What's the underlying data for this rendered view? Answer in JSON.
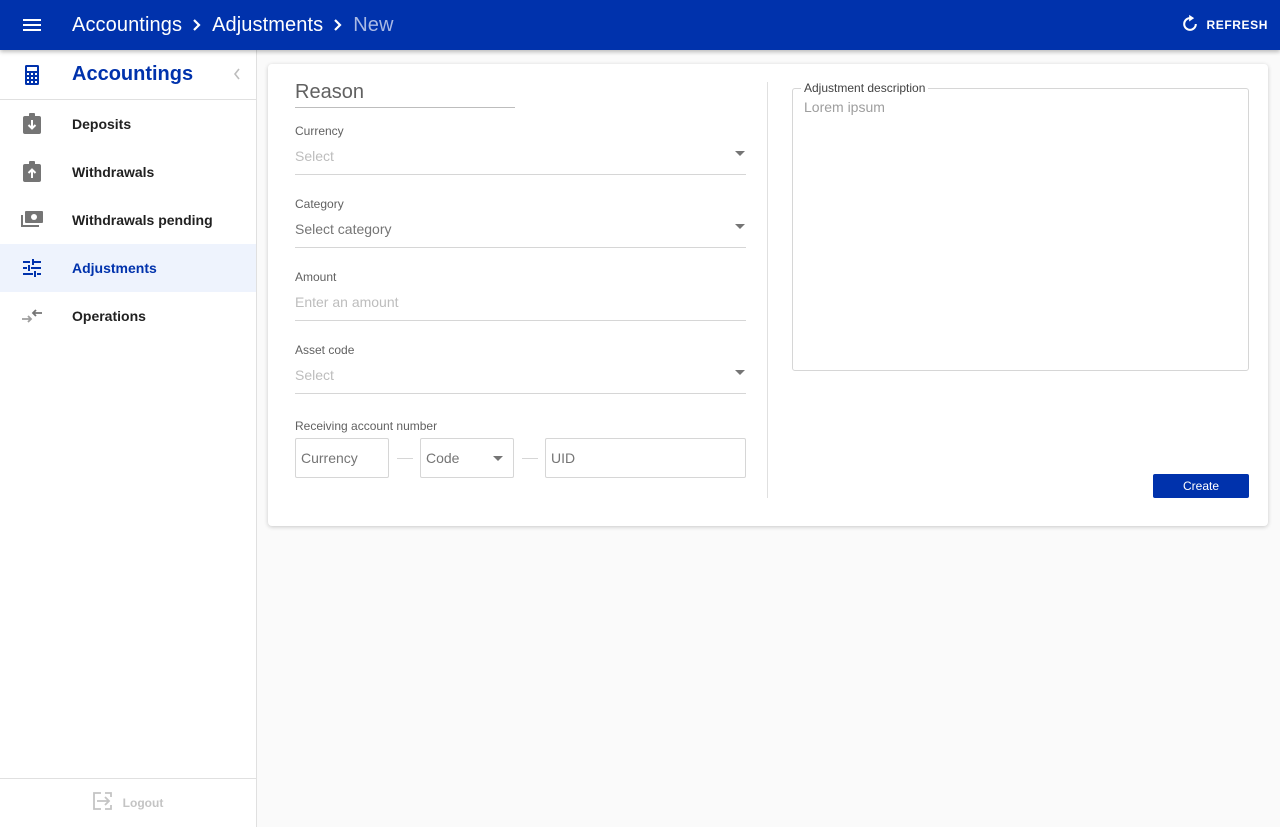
{
  "appbar": {
    "breadcrumbs": [
      "Accountings",
      "Adjustments",
      "New"
    ],
    "refresh_label": "REFRESH",
    "background": "#0032ac"
  },
  "sidebar": {
    "title": "Accountings",
    "title_icon": "calculator-icon",
    "items": [
      {
        "label": "Deposits",
        "icon": "deposit-icon",
        "active": false
      },
      {
        "label": "Withdrawals",
        "icon": "withdrawal-icon",
        "active": false
      },
      {
        "label": "Withdrawals pending",
        "icon": "money-icon",
        "active": false
      },
      {
        "label": "Adjustments",
        "icon": "tune-icon",
        "active": true
      },
      {
        "label": "Operations",
        "icon": "compare-arrows-icon",
        "active": false
      }
    ],
    "logout_label": "Logout"
  },
  "form": {
    "reason_title": "Reason",
    "fields": {
      "currency": {
        "label": "Currency",
        "placeholder": "Select"
      },
      "category": {
        "label": "Category",
        "value": "Select category"
      },
      "amount": {
        "label": "Amount",
        "placeholder": "Enter an amount"
      },
      "asset_code": {
        "label": "Asset code",
        "placeholder": "Select"
      }
    },
    "receiving_account": {
      "label": "Receiving account number",
      "currency_placeholder": "Currency",
      "code_placeholder": "Code",
      "uid_placeholder": "UID"
    },
    "description": {
      "label": "Adjustment description",
      "value": "Lorem ipsum"
    },
    "create_label": "Create"
  }
}
